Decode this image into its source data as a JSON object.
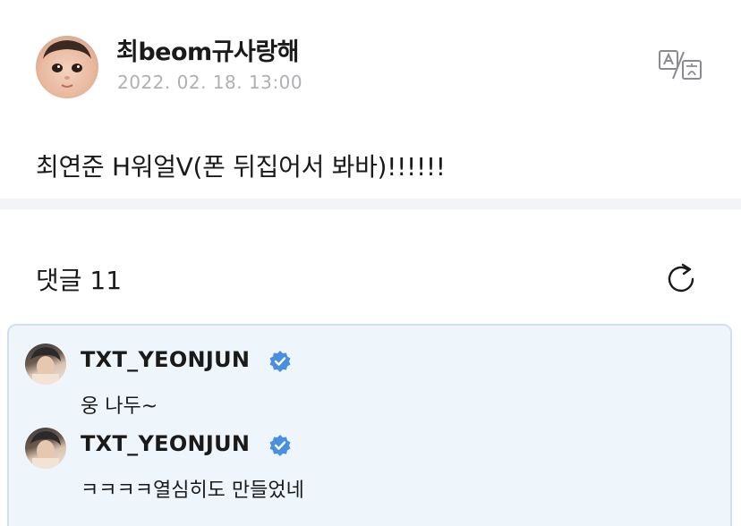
{
  "post": {
    "author": "최beom규사랑해",
    "date": "2022. 02. 18. 13:00",
    "body": "최연준 H워얼V(폰 뒤집어서 봐바)!!!!!!",
    "translate_icon": "translate-icon"
  },
  "comments_section": {
    "title": "댓글 11",
    "refresh_icon": "refresh-icon"
  },
  "comments": [
    {
      "author": "TXT_YEONJUN",
      "verified": true,
      "text": "웅 나두~"
    },
    {
      "author": "TXT_YEONJUN",
      "verified": true,
      "text": "ㅋㅋㅋㅋ열심히도 만들었네"
    }
  ],
  "colors": {
    "verified_badge": "#4a90e2",
    "comment_highlight_bg": "#eef5fb",
    "comment_highlight_border": "#cfe0ef",
    "date_text": "#b0b0b4"
  }
}
